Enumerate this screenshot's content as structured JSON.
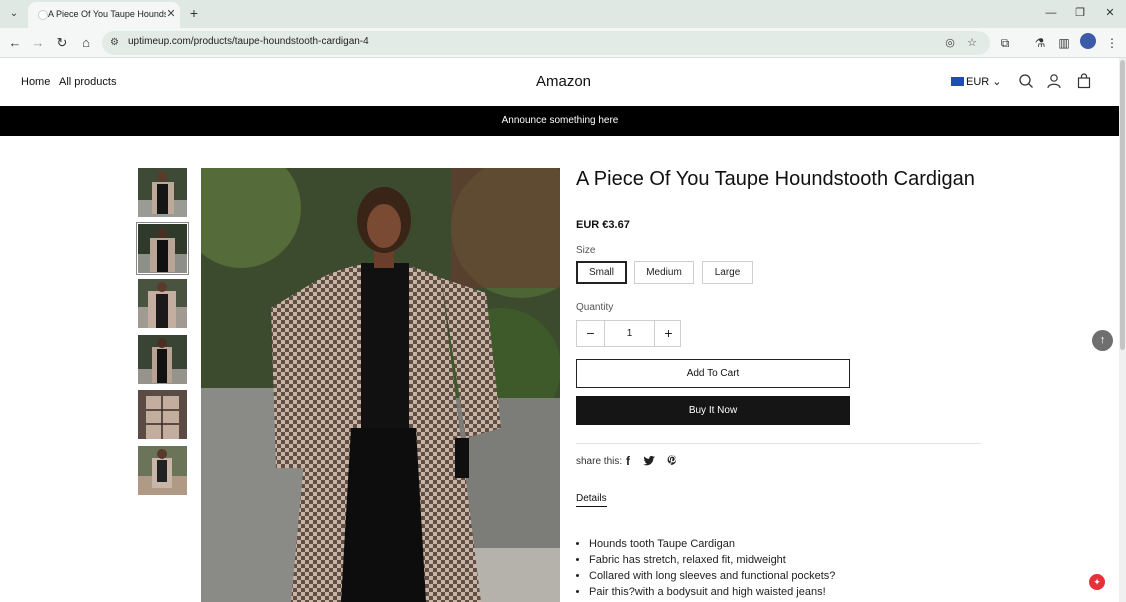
{
  "browser": {
    "tab_title": "A Piece Of You Taupe Houndstooth Cardigan",
    "url": "uptimeup.com/products/taupe-houndstooth-cardigan-4",
    "tab_switch_icon": "chevron-down-icon",
    "new_tab_icon": "plus-icon"
  },
  "header": {
    "nav": [
      "Home",
      "All products"
    ],
    "brand": "Amazon",
    "currency": "EUR"
  },
  "announcement": "Announce something here",
  "product": {
    "title": "A Piece Of You Taupe Houndstooth Cardigan",
    "price": "EUR €3.67",
    "size_label": "Size",
    "sizes": [
      "Small",
      "Medium",
      "Large"
    ],
    "selected_size": "Small",
    "quantity_label": "Quantity",
    "quantity": "1",
    "add_to_cart": "Add To Cart",
    "buy_now": "Buy It Now",
    "share_label": "share this:",
    "details_tab": "Details",
    "details": [
      "Hounds tooth Taupe Cardigan",
      "Fabric has stretch, relaxed fit, midweight",
      "Collared with long sleeves and functional pockets?",
      "Pair this?with a bodysuit and high waisted jeans!"
    ]
  },
  "colors": {
    "announce_bg": "#000000",
    "buy_bg": "#151515",
    "chrome_bg": "#dfe8e3"
  }
}
